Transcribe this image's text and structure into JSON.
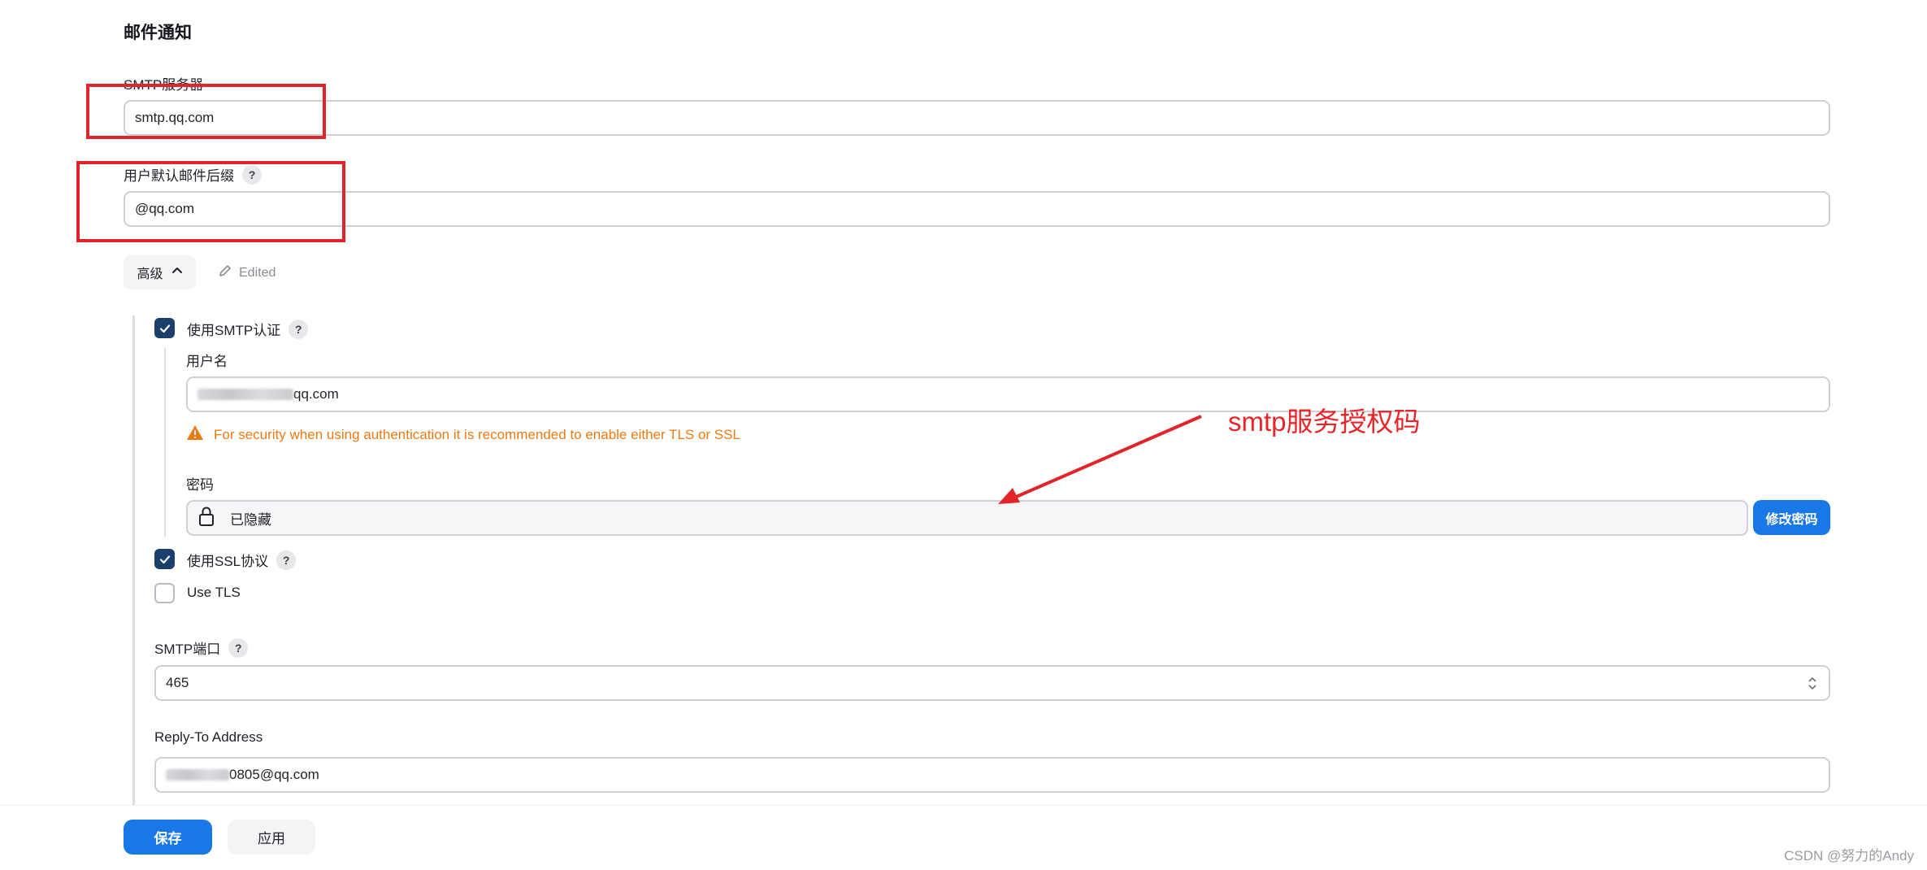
{
  "section": {
    "title": "邮件通知"
  },
  "smtp_server": {
    "label": "SMTP服务器",
    "value": "smtp.qq.com"
  },
  "default_suffix": {
    "label": "用户默认邮件后缀",
    "help": "?",
    "value": "@qq.com"
  },
  "advanced": {
    "label": "高级",
    "edited": "Edited"
  },
  "smtp_auth": {
    "label": "使用SMTP认证",
    "help": "?",
    "checked": true,
    "username_label": "用户名",
    "username_value": "qq.com",
    "warning": "For security when using authentication it is recommended to enable either TLS or SSL",
    "password_label": "密码",
    "password_value": "已隐藏",
    "change_password": "修改密码"
  },
  "ssl": {
    "label": "使用SSL协议",
    "help": "?",
    "checked": true
  },
  "tls": {
    "label": "Use TLS",
    "checked": false
  },
  "smtp_port": {
    "label": "SMTP端口",
    "help": "?",
    "value": "465"
  },
  "reply_to": {
    "label": "Reply-To Address",
    "value": "0805@qq.com"
  },
  "annotation": {
    "text": "smtp服务授权码"
  },
  "footer": {
    "save": "保存",
    "apply": "应用"
  },
  "watermark": "CSDN @努力的Andy",
  "colors": {
    "primary": "#1878e6",
    "annotation_red": "#e0242a",
    "warning": "#f07a12",
    "checkbox": "#1a3f6b"
  }
}
